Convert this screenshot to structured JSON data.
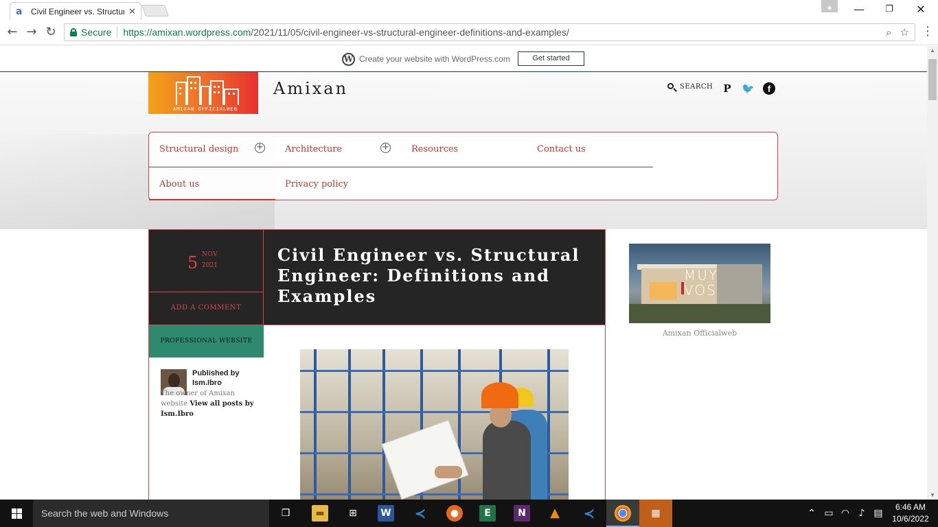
{
  "browser": {
    "tab_title": "Civil Engineer vs. Structural Engineer: Definitions and Examples",
    "secure_label": "Secure",
    "url_host": "https://amixan.wordpress.com",
    "url_path": "/2021/11/05/civil-engineer-vs-structural-engineer-definitions-and-examples/"
  },
  "wp_bar": {
    "text": "Create your website with WordPress.com",
    "button": "Get started"
  },
  "site": {
    "title": "Amixan",
    "logo_caption": "AMIXAN OFFICIALWEB",
    "search_label": "SEARCH"
  },
  "nav": {
    "items": [
      {
        "label": "Structural design"
      },
      {
        "label": "Architecture"
      },
      {
        "label": "Resources"
      },
      {
        "label": "Contact us"
      },
      {
        "label": "About us"
      },
      {
        "label": "Privacy policy"
      }
    ]
  },
  "post": {
    "day": "5",
    "month": "NOV",
    "year": "2021",
    "comment_label": "ADD A COMMENT",
    "category": "PROFESSIONAL WEBSITE",
    "title": "Civil Engineer vs. Structural Engineer: Definitions and Examples",
    "author_label": "Published by Ism.Ibro",
    "author_bio": "The owner of Amixan website",
    "view_all": "View all posts by Ism.Ibro"
  },
  "sidebar": {
    "image_text_1": "MUY",
    "image_text_2": "VOS",
    "caption": "Amixan Officialweb"
  },
  "taskbar": {
    "search_placeholder": "Search the web and Windows",
    "time": "6:46 AM",
    "date": "10/6/2022"
  },
  "colors": {
    "accent": "#d9454a",
    "dark_panel": "#252525",
    "category_green": "#2e8a6e",
    "secure_green": "#0b8043"
  }
}
